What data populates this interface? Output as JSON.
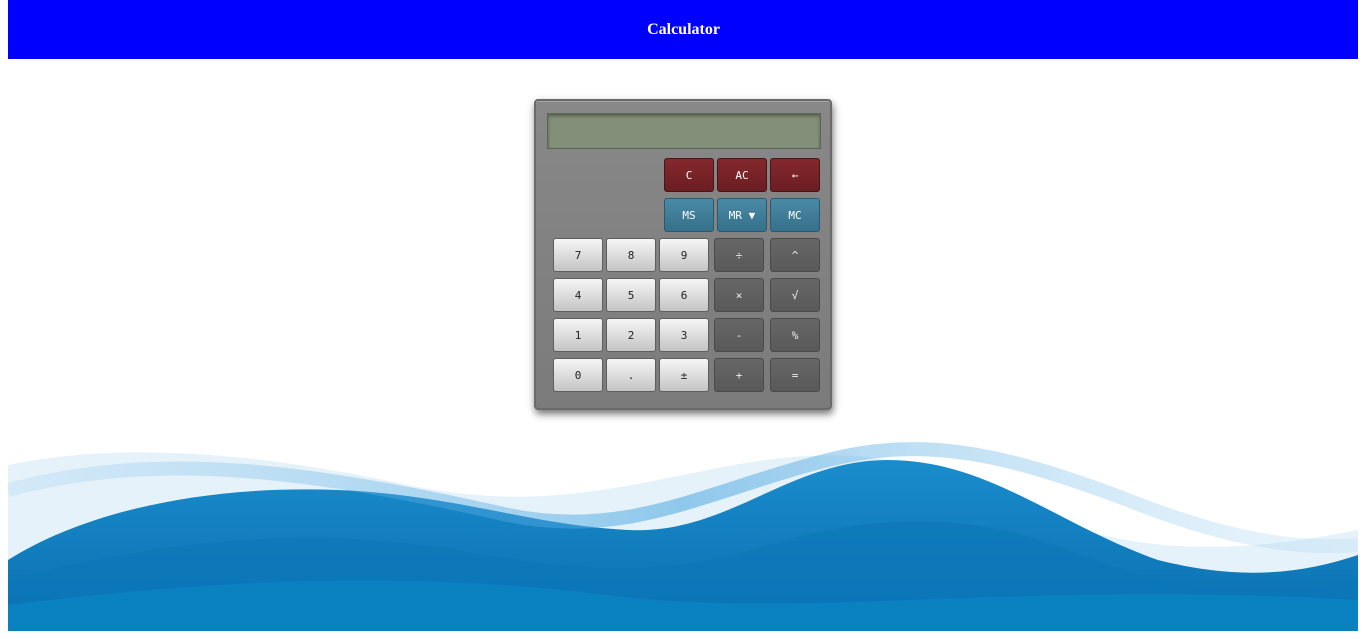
{
  "header": {
    "title": "Calculator",
    "background_color": "#0000ff"
  },
  "calculator": {
    "display_value": "",
    "clear_label": "C",
    "all_clear_label": "AC",
    "backspace_label": "←",
    "memory_store_label": "MS",
    "memory_recall_label": "MR ▼",
    "memory_clear_label": "MC",
    "keys": {
      "seven": "7",
      "eight": "8",
      "nine": "9",
      "divide": "÷",
      "power": "^",
      "four": "4",
      "five": "5",
      "six": "6",
      "multiply": "×",
      "sqrt": "√",
      "one": "1",
      "two": "2",
      "three": "3",
      "minus": "-",
      "percent": "%",
      "zero": "0",
      "decimal": ".",
      "plus_minus": "±",
      "plus": "+",
      "equals": "="
    },
    "colors": {
      "body": "#848484",
      "display": "#848f79",
      "clear_keys": "#7a2328",
      "memory_keys": "#40809c"
    }
  }
}
